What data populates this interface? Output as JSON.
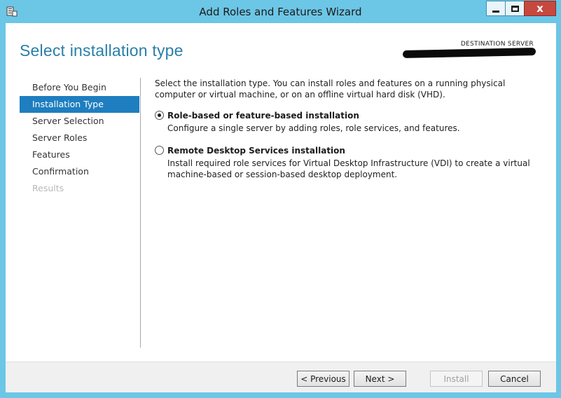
{
  "window": {
    "title": "Add Roles and Features Wizard",
    "close_glyph": "x"
  },
  "page": {
    "title": "Select installation type",
    "destination_label": "DESTINATION SERVER"
  },
  "nav": {
    "items": [
      {
        "label": "Before You Begin",
        "state": "normal"
      },
      {
        "label": "Installation Type",
        "state": "active"
      },
      {
        "label": "Server Selection",
        "state": "normal"
      },
      {
        "label": "Server Roles",
        "state": "normal"
      },
      {
        "label": "Features",
        "state": "normal"
      },
      {
        "label": "Confirmation",
        "state": "normal"
      },
      {
        "label": "Results",
        "state": "disabled"
      }
    ]
  },
  "content": {
    "intro": "Select the installation type. You can install roles and features on a running physical computer or virtual machine, or on an offline virtual hard disk (VHD).",
    "options": [
      {
        "title": "Role-based or feature-based installation",
        "description": "Configure a single server by adding roles, role services, and features.",
        "selected": true
      },
      {
        "title": "Remote Desktop Services installation",
        "description": "Install required role services for Virtual Desktop Infrastructure (VDI) to create a virtual machine-based or session-based desktop deployment.",
        "selected": false
      }
    ]
  },
  "footer": {
    "previous_label": "< Previous",
    "next_label": "Next >",
    "install_label": "Install",
    "cancel_label": "Cancel"
  },
  "colors": {
    "titlebar": "#6cc6e6",
    "accent": "#2a7fa8",
    "nav_active": "#1e7ebf",
    "close_button": "#c7483f"
  }
}
